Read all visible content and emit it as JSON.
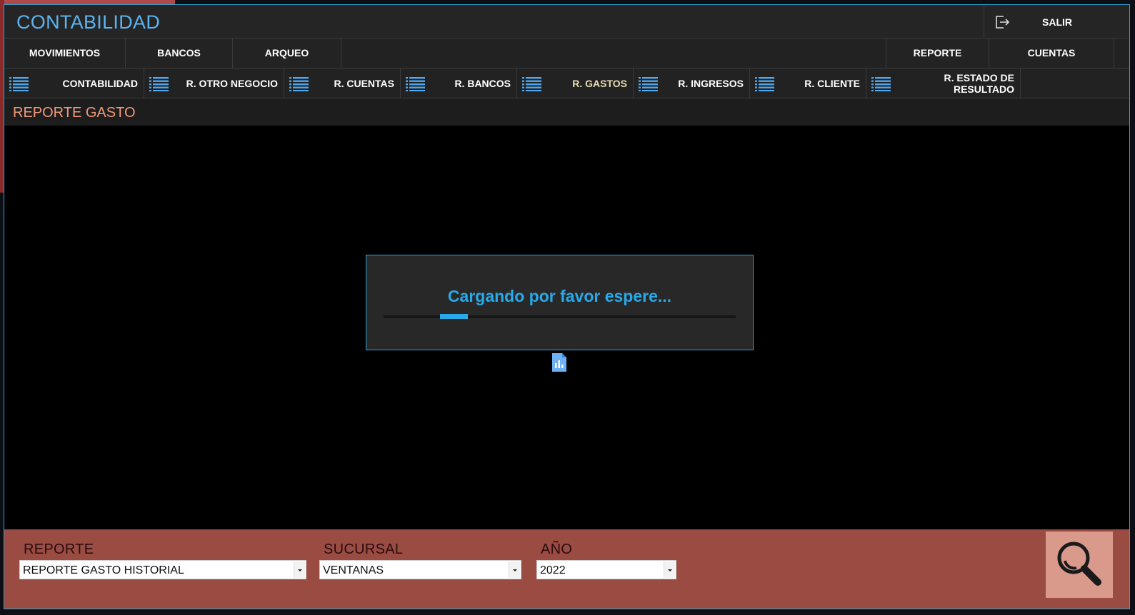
{
  "window": {
    "title": "CONTABILIDAD",
    "exit_label": "SALIR"
  },
  "nav": {
    "left": [
      "MOVIMIENTOS",
      "BANCOS",
      "ARQUEO"
    ],
    "right": [
      "REPORTE",
      "CUENTAS"
    ]
  },
  "subtabs": [
    {
      "label": "CONTABILIDAD"
    },
    {
      "label": "R. OTRO NEGOCIO"
    },
    {
      "label": "R. CUENTAS"
    },
    {
      "label": "R. BANCOS"
    },
    {
      "label": "R. GASTOS",
      "active": true
    },
    {
      "label": "R. INGRESOS"
    },
    {
      "label": "R. CLIENTE"
    },
    {
      "label": "R.  ESTADO DE RESULTADO"
    }
  ],
  "section": {
    "title": "REPORTE GASTO"
  },
  "loading": {
    "message": "Cargando por favor espere...",
    "progress_fraction": 0.08
  },
  "filters": {
    "reporte": {
      "label": "REPORTE",
      "value": "REPORTE GASTO HISTORIAL"
    },
    "sucursal": {
      "label": "SUCURSAL",
      "value": "VENTANAS"
    },
    "anio": {
      "label": "AÑO",
      "value": "2022"
    }
  },
  "icons": {
    "exit": "exit-icon",
    "list": "list-icon",
    "report": "report-chart-icon",
    "search": "search-icon"
  },
  "colors": {
    "accent": "#29a9e8",
    "title": "#5bb3f0",
    "section_title": "#f09a78",
    "footer_bg": "#9a4b42",
    "search_bg": "#d99a8c",
    "active_tab": "#e8dcb0"
  }
}
